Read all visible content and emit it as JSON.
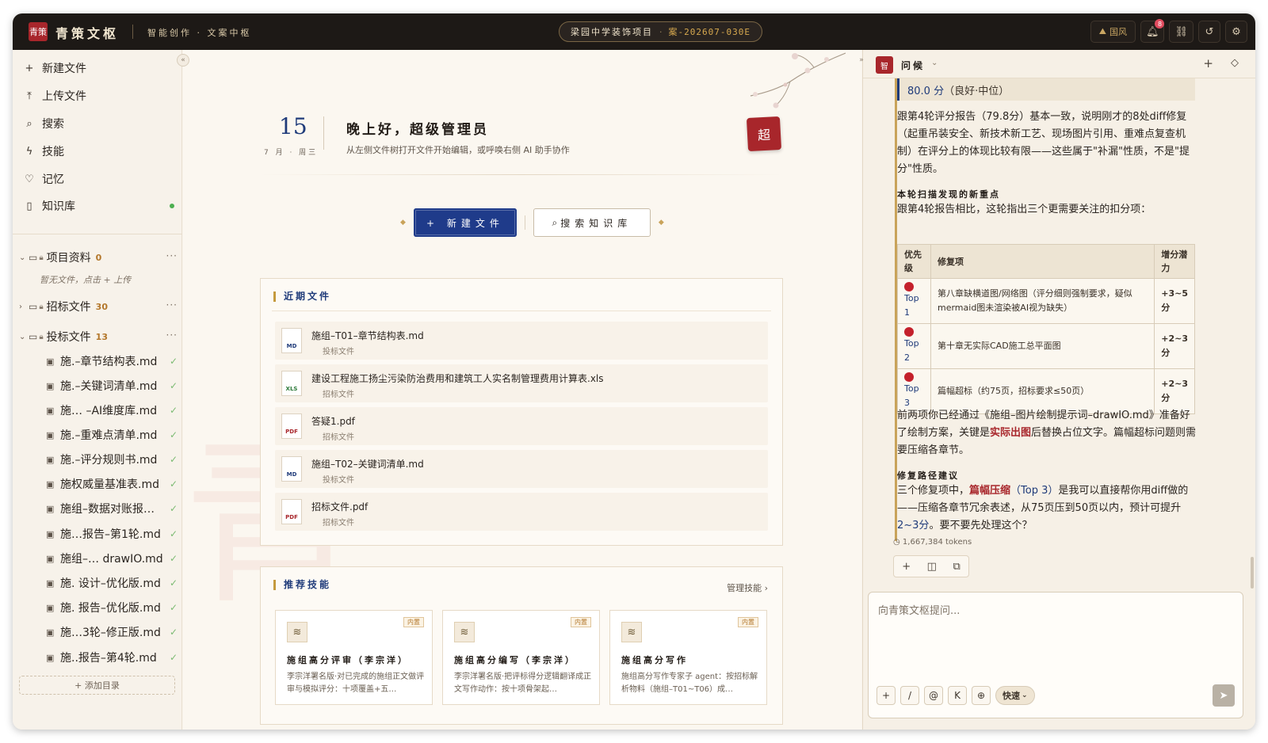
{
  "topbar": {
    "logo": "青策",
    "brand": "青策文枢",
    "subtitle": "智能创作 · 文案中枢",
    "project_name": "梁园中学装饰项目",
    "project_sep": "·",
    "project_code": "案-202607-030E",
    "theme_label": "国风",
    "notif_count": "8"
  },
  "sidebar": {
    "collapse": "«",
    "items": [
      {
        "icon": "+",
        "label": "新建文件"
      },
      {
        "icon": "⤒",
        "label": "上传文件"
      },
      {
        "icon": "⌕",
        "label": "搜索"
      },
      {
        "icon": "ϟ",
        "label": "技能"
      },
      {
        "icon": "♡",
        "label": "记忆"
      },
      {
        "icon": "▯",
        "label": "知识库"
      }
    ],
    "folders": [
      {
        "name": "项目资料",
        "count": "0",
        "expanded": "⌄"
      },
      {
        "name": "招标文件",
        "count": "30",
        "expanded": "›"
      },
      {
        "name": "投标文件",
        "count": "13",
        "expanded": "⌄"
      }
    ],
    "empty_hint": "暂无文件，点击 + 上传",
    "files": [
      "施.–章节结构表.md",
      "施.–关键词清单.md",
      "施… –AI维度库.md",
      "施.–重难点清单.md",
      "施.–评分规则书.md",
      "施权威量基准表.md",
      "施组–数据对账报…",
      "施…报告–第1轮.md",
      "施组–… drawIO.md",
      "施. 设计–优化版.md",
      "施. 报告–优化版.md",
      "施…3轮–修正版.md",
      "施..报告–第4轮.md"
    ],
    "add_dir": "+ 添加目录"
  },
  "center": {
    "collapse": "»",
    "day": "15",
    "date_sub": "7 月 · 周三",
    "greeting": "晚上好，超级管理员",
    "greeting_sub": "从左侧文件树打开文件开始编辑，或呼唤右侧 AI 助手协作",
    "avatar": "超",
    "watermark": "青",
    "btn_new": "+ 新建文件",
    "btn_search": "搜索知识库",
    "recent_title": "近期文件",
    "recent": [
      {
        "type": "MD",
        "name": "施组–T01–章节结构表.md",
        "cat": "投标文件"
      },
      {
        "type": "XLS",
        "name": "建设工程施工扬尘污染防治费用和建筑工人实名制管理费用计算表.xls",
        "cat": "招标文件"
      },
      {
        "type": "PDF",
        "name": "答疑1.pdf",
        "cat": "招标文件"
      },
      {
        "type": "MD",
        "name": "施组–T02–关键词清单.md",
        "cat": "投标文件"
      },
      {
        "type": "PDF",
        "name": "招标文件.pdf",
        "cat": "招标文件"
      }
    ],
    "skills_title": "推荐技能",
    "manage_skills": "管理技能 ›",
    "skills": [
      {
        "tag": "内置",
        "title": "施组高分评审（李宗洋）",
        "desc": "李宗洋署名版·对已完成的施组正文做评审与模拟评分：十项覆盖+五…"
      },
      {
        "tag": "内置",
        "title": "施组高分编写（李宗洋）",
        "desc": "李宗洋署名版·把评标得分逻辑翻译成正文写作动作：按十项骨架起…"
      },
      {
        "tag": "内置",
        "title": "施组高分写作",
        "desc": "施组高分写作专家子 agent：按招标解析物料（施组–T01~T06）成…"
      }
    ]
  },
  "assistant": {
    "seal": "智",
    "title": "问候",
    "score_value": "80.0 分",
    "score_note": "（良好·中位）",
    "para1": "跟第4轮评分报告（79.8分）基本一致，说明刚才的8处diff修复（起重吊装安全、新技术新工艺、现场图片引用、重难点复查机制）在评分上的体现比较有限——这些属于\"补漏\"性质，不是\"提分\"性质。",
    "h_new": "本轮扫描发现的新重点",
    "para2": "跟第4轮报告相比，这轮指出三个更需要关注的扣分项：",
    "table_head": [
      "优先级",
      "修复项",
      "增分潜力"
    ],
    "table_rows": [
      {
        "top": "Top 1",
        "item": "第八章缺横道图/网络图（评分细则强制要求，疑似mermaid图未渲染被AI视为缺失）",
        "gain": "+3~5分"
      },
      {
        "top": "Top 2",
        "item": "第十章无实际CAD施工总平面图",
        "gain": "+2~3分"
      },
      {
        "top": "Top 3",
        "item": "篇幅超标（约75页，招标要求≤50页）",
        "gain": "+2~3分"
      }
    ],
    "para3_a": "前两项你已经通过《施组–图片绘制提示词–drawIO.md》准备好了绘制方案，关键是",
    "para3_em": "实际出图",
    "para3_b": "后替换占位文字。篇幅超标问题则需要压缩各章节。",
    "h_path": "修复路径建议",
    "para4_a": "三个修复项中，",
    "para4_em": "篇幅压缩",
    "para4_b": "（Top 3）",
    "para4_c": "是我可以直接帮你用diff做的——压缩各章节冗余表述，从75页压到50页以内，预计可提升",
    "para4_em2": "2~3分",
    "para4_d": "。要不要先处理这个？",
    "tokens": "1,667,384 tokens",
    "input_placeholder": "向青策文枢提问...",
    "mode": "快速"
  }
}
